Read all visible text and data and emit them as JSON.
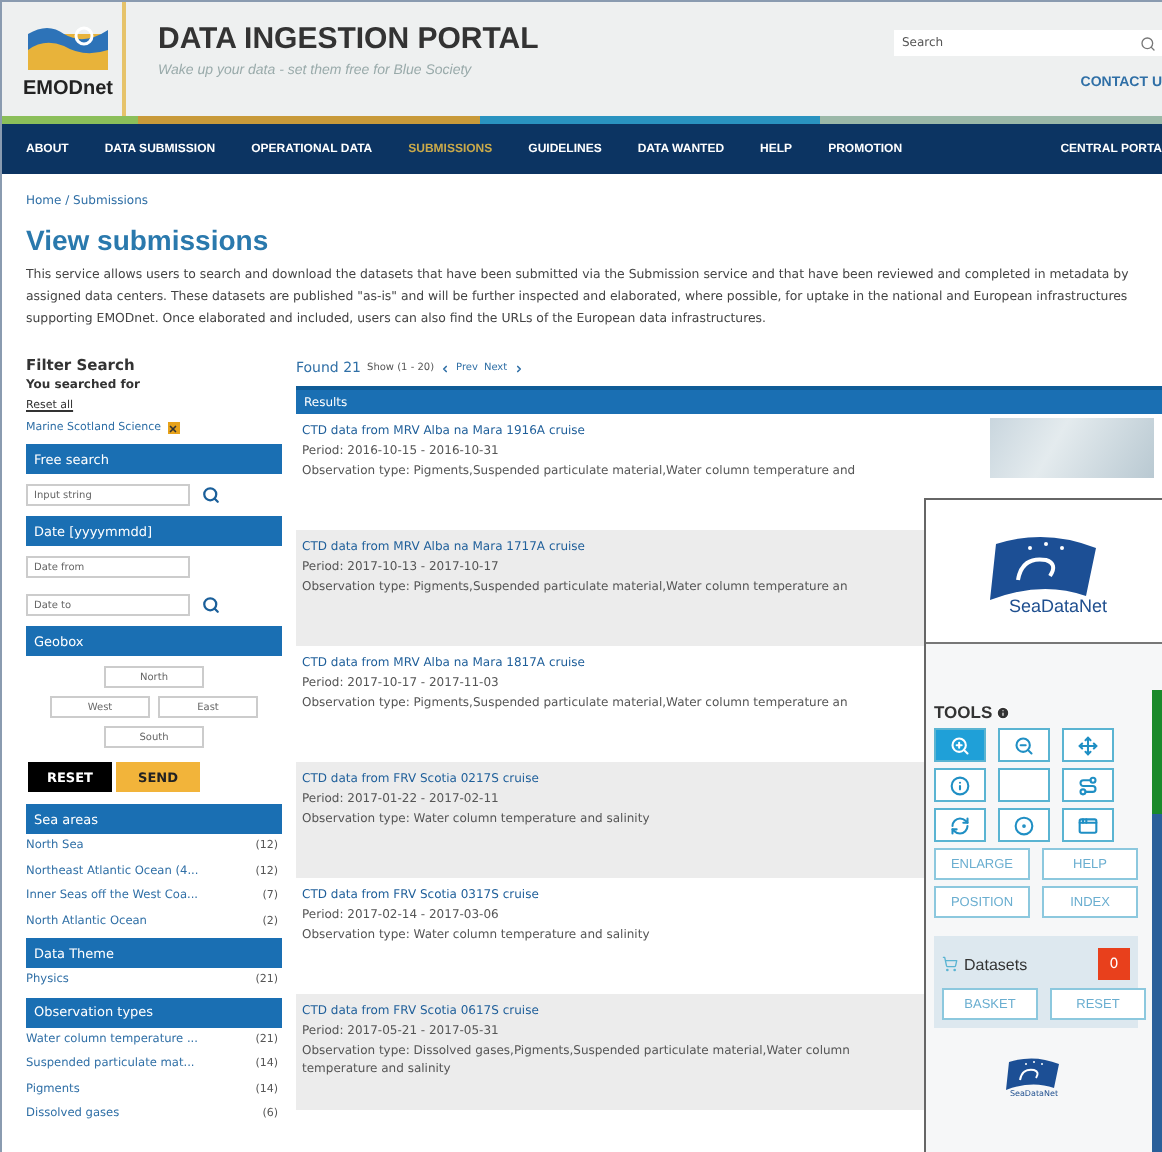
{
  "header": {
    "logo_text": "EMODnet",
    "title": "DATA INGESTION PORTAL",
    "tagline": "Wake up your data - set them free for Blue Society",
    "search_placeholder": "Search",
    "contact": "CONTACT U"
  },
  "nav": [
    {
      "label": "ABOUT",
      "selected": false
    },
    {
      "label": "DATA SUBMISSION",
      "selected": false
    },
    {
      "label": "OPERATIONAL DATA",
      "selected": false
    },
    {
      "label": "SUBMISSIONS",
      "selected": true
    },
    {
      "label": "GUIDELINES",
      "selected": false
    },
    {
      "label": "DATA WANTED",
      "selected": false
    },
    {
      "label": "HELP",
      "selected": false
    },
    {
      "label": "PROMOTION",
      "selected": false
    },
    {
      "label": "CENTRAL PORTA",
      "selected": false
    }
  ],
  "breadcrumb": "Home / Submissions",
  "page_title": "View submissions",
  "description": "This service allows users to search and download the datasets that have been submitted via the Submission service and that have been reviewed and completed in metadata by assigned data centers. These datasets are published \"as-is\" and will be further inspected and elaborated, where possible, for uptake in the national and European infrastructures supporting EMODnet. Once elaborated and included, users can also find the URLs of the European data infrastructures.",
  "filter": {
    "title": "Filter Search",
    "searched_for": "You searched for",
    "reset_all": "Reset all",
    "active_filter": "Marine Scotland Science",
    "free_search": {
      "title": "Free search",
      "placeholder": "Input string"
    },
    "date": {
      "title": "Date [yyyymmdd]",
      "from_placeholder": "Date from",
      "to_placeholder": "Date to"
    },
    "geobox": {
      "title": "Geobox",
      "fields": [
        {
          "placeholder": "North"
        },
        {
          "placeholder": "West"
        },
        {
          "placeholder": "East"
        },
        {
          "placeholder": "South"
        }
      ]
    },
    "reset_button": "RESET",
    "send_button": "SEND",
    "facets": [
      {
        "title": "Sea areas",
        "items": [
          {
            "label": "North Sea",
            "count": "(12)"
          },
          {
            "label": "Northeast Atlantic Ocean (4...",
            "count": "(12)"
          },
          {
            "label": "Inner Seas off the West Coa...",
            "count": "(7)"
          },
          {
            "label": "North Atlantic Ocean",
            "count": "(2)"
          }
        ]
      },
      {
        "title": "Data Theme",
        "items": [
          {
            "label": "Physics",
            "count": "(21)"
          }
        ]
      },
      {
        "title": "Observation types",
        "items": [
          {
            "label": "Water column temperature ...",
            "count": "(21)"
          },
          {
            "label": "Suspended particulate mat...",
            "count": "(14)"
          },
          {
            "label": "Pigments",
            "count": "(14)"
          },
          {
            "label": "Dissolved gases",
            "count": "(6)"
          }
        ]
      }
    ]
  },
  "results": {
    "found": "Found 21",
    "show": "Show (1 - 20)",
    "prev": "Prev",
    "next": "Next",
    "header": "Results",
    "rows": [
      {
        "title": "CTD data from MRV Alba na Mara 1916A cruise",
        "period": "Period: 2016-10-15 - 2016-10-31",
        "observation": "Observation type: Pigments,Suspended particulate material,Water column temperature and"
      },
      {
        "title": "CTD data from MRV Alba na Mara 1717A cruise",
        "period": "Period: 2017-10-13 - 2017-10-17",
        "observation": "Observation type: Pigments,Suspended particulate material,Water column temperature an"
      },
      {
        "title": "CTD data from MRV Alba na Mara 1817A cruise",
        "period": "Period: 2017-10-17 - 2017-11-03",
        "observation": "Observation type: Pigments,Suspended particulate material,Water column temperature an"
      },
      {
        "title": "CTD data from FRV Scotia 0217S cruise",
        "period": "Period: 2017-01-22 - 2017-02-11",
        "observation": "Observation type: Water column temperature and salinity"
      },
      {
        "title": "CTD data from FRV Scotia 0317S cruise",
        "period": "Period: 2017-02-14 - 2017-03-06",
        "observation": "Observation type: Water column temperature and salinity"
      },
      {
        "title": "CTD data from FRV Scotia 0617S cruise",
        "period": "Period: 2017-05-21 - 2017-05-31",
        "observation": "Observation type: Dissolved gases,Pigments,Suspended particulate material,Water column temperature and salinity"
      }
    ]
  },
  "viewer": {
    "logo_text": "SeaDataNet",
    "tools_title": "TOOLS",
    "tools": [
      {
        "kind": "zoom-in",
        "selected": true
      },
      {
        "kind": "zoom-out",
        "selected": false
      },
      {
        "kind": "pan",
        "selected": false
      },
      {
        "kind": "info",
        "selected": false
      },
      {
        "kind": "blank",
        "selected": false
      },
      {
        "kind": "route",
        "selected": false
      },
      {
        "kind": "refresh",
        "selected": false
      },
      {
        "kind": "circle",
        "selected": false
      },
      {
        "kind": "window",
        "selected": false
      }
    ],
    "text_buttons": [
      "ENLARGE",
      "HELP",
      "POSITION",
      "INDEX"
    ],
    "datasets_label": "Datasets",
    "datasets_count": "0",
    "basket_button": "BASKET",
    "reset_button": "RESET",
    "footer_logo_text": "SeaDataNet"
  }
}
